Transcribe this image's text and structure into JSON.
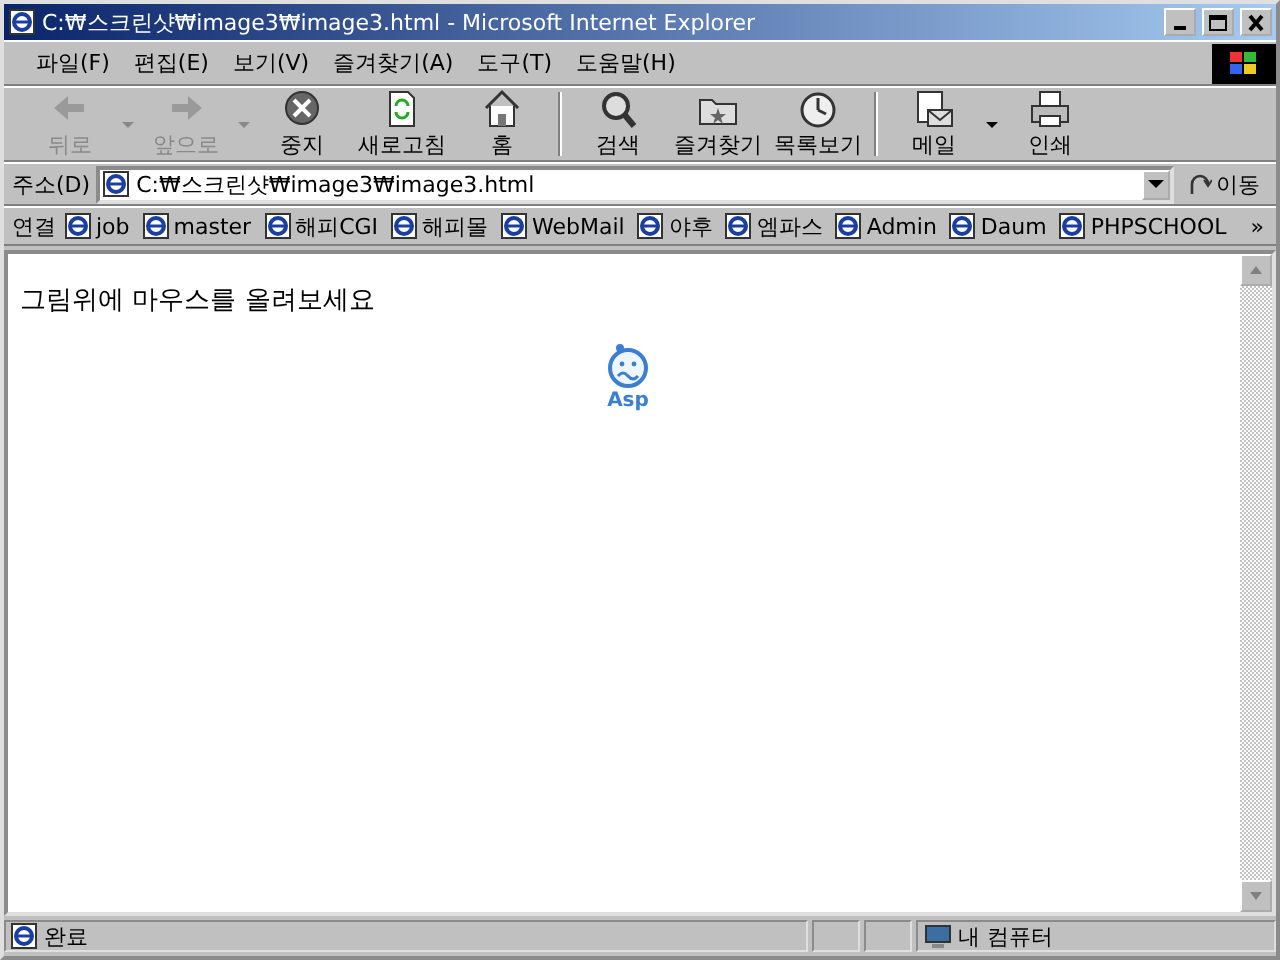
{
  "window": {
    "title": "C:₩스크린샷₩image3₩image3.html - Microsoft Internet Explorer"
  },
  "menu": [
    "파일(F)",
    "편집(E)",
    "보기(V)",
    "즐겨찾기(A)",
    "도구(T)",
    "도움말(H)"
  ],
  "toolbar": [
    {
      "kind": "back",
      "label": "뒤로",
      "disabled": true,
      "dropdown": true
    },
    {
      "kind": "forward",
      "label": "앞으로",
      "disabled": true,
      "dropdown": true
    },
    {
      "kind": "stop",
      "label": "중지",
      "disabled": false,
      "dropdown": false
    },
    {
      "kind": "refresh",
      "label": "새로고침",
      "disabled": false,
      "dropdown": false
    },
    {
      "kind": "home",
      "label": "홈",
      "disabled": false,
      "dropdown": false
    },
    {
      "kind": "search",
      "label": "검색",
      "disabled": false,
      "dropdown": false,
      "separator": true
    },
    {
      "kind": "favorites",
      "label": "즐겨찾기",
      "disabled": false,
      "dropdown": false
    },
    {
      "kind": "history",
      "label": "목록보기",
      "disabled": false,
      "dropdown": false
    },
    {
      "kind": "mail",
      "label": "메일",
      "disabled": false,
      "dropdown": true,
      "separator": true
    },
    {
      "kind": "print",
      "label": "인쇄",
      "disabled": false,
      "dropdown": false
    }
  ],
  "address": {
    "label": "주소(D)",
    "value": "C:₩스크린샷₩image3₩image3.html",
    "go": "이동"
  },
  "links": {
    "label": "연결",
    "items": [
      "job",
      "master",
      "해피CGI",
      "해피몰",
      "WebMail",
      "야후",
      "엠파스",
      "Admin",
      "Daum",
      "PHPSCHOOL"
    ],
    "more": "»"
  },
  "content": {
    "text": "그림위에 마우스를 올려보세요",
    "logo_caption": "Asp"
  },
  "status_bar": {
    "text": "완료",
    "zone": "내 컴퓨터"
  }
}
